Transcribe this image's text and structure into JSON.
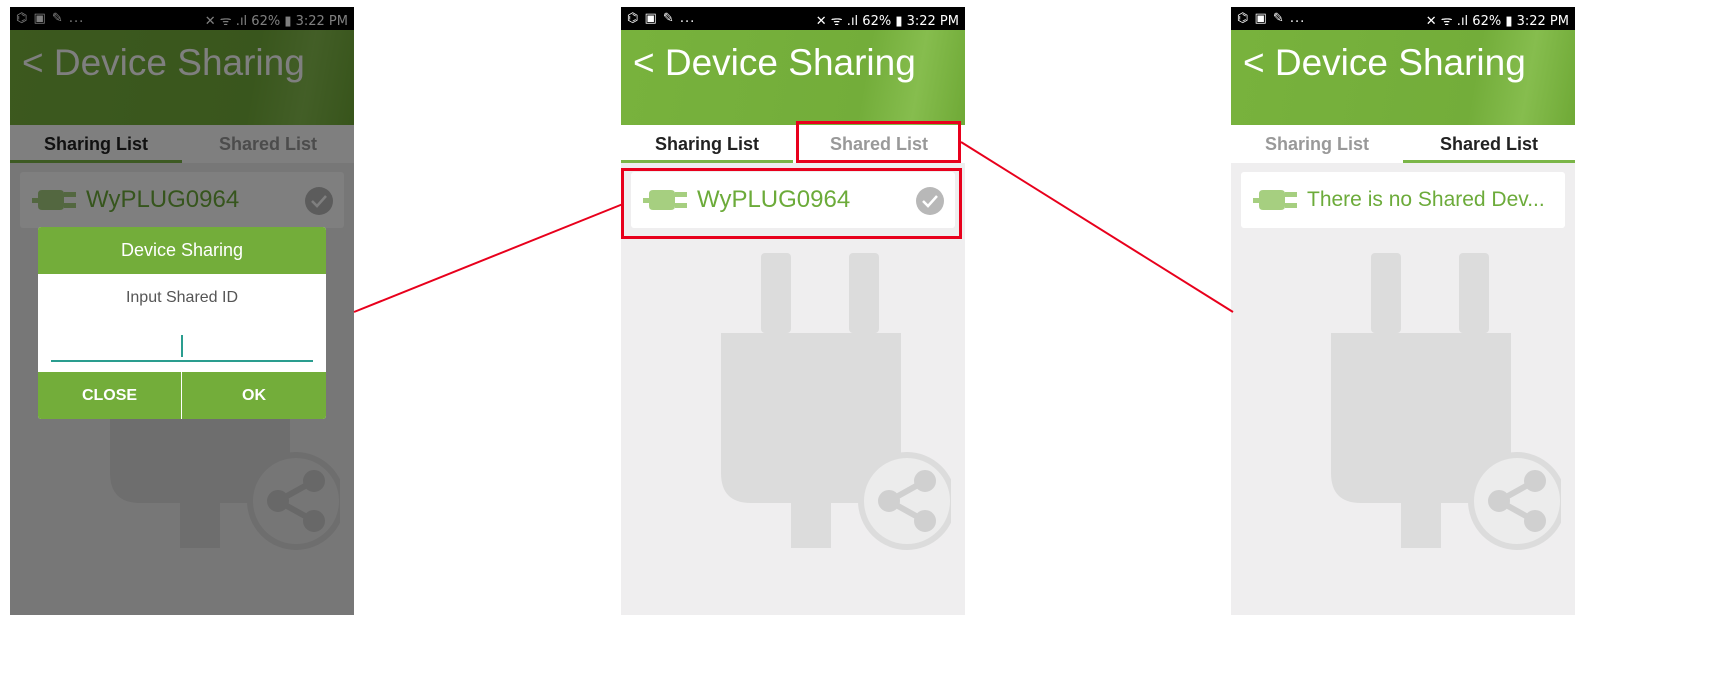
{
  "colors": {
    "brand_green": "#73ad3a",
    "accent_green": "#7ab547",
    "highlight_red": "#e8001c",
    "input_underline": "#2a9d8f"
  },
  "status_bar": {
    "left_icons": "⌬  ▣ ✎ ...",
    "right": "✕ ᯤ .ıl 62% ▮ 3:22 PM"
  },
  "header": {
    "title": "< Device Sharing"
  },
  "tabs": {
    "sharing_list": "Sharing List",
    "shared_list": "Shared List"
  },
  "screens": {
    "left": {
      "active_tab": "sharing_list",
      "device_name": "WyPLUG0964",
      "dialog": {
        "title": "Device Sharing",
        "message": "Input Shared ID",
        "input_value": "",
        "close_button": "CLOSE",
        "ok_button": "OK"
      }
    },
    "middle": {
      "active_tab": "sharing_list",
      "device_name": "WyPLUG0964"
    },
    "right": {
      "active_tab": "shared_list",
      "empty_message": "There is no Shared Dev..."
    }
  },
  "icons": {
    "plug": "plug-icon",
    "check": "check-circle-icon",
    "share": "share-icon",
    "back": "back-chevron"
  }
}
